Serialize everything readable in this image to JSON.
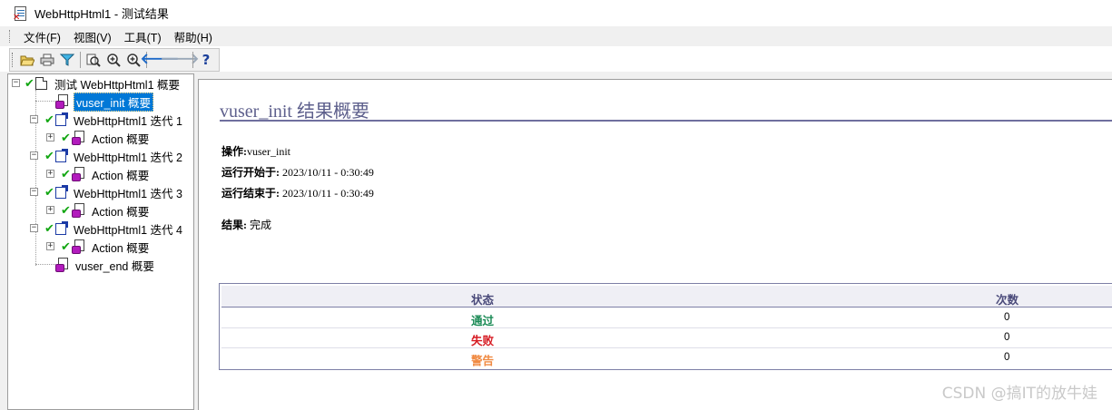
{
  "window": {
    "title": "WebHttpHtml1 - 测试结果"
  },
  "menu": [
    {
      "label": "文件(F)"
    },
    {
      "label": "视图(V)"
    },
    {
      "label": "工具(T)"
    },
    {
      "label": "帮助(H)"
    }
  ],
  "toolbar": {
    "icons": [
      "open-folder-icon",
      "print-icon",
      "filter-icon",
      "find-icon",
      "zoom-in-icon",
      "zoom-out-icon",
      "back-arrow-icon",
      "forward-arrow-icon",
      "help-icon"
    ],
    "help_glyph": "?"
  },
  "tree": {
    "root": "测试 WebHttpHtml1 概要",
    "vuser_init": "vuser_init 概要",
    "iterations": [
      {
        "label": "WebHttpHtml1 迭代 1",
        "action": "Action 概要"
      },
      {
        "label": "WebHttpHtml1 迭代 2",
        "action": "Action 概要"
      },
      {
        "label": "WebHttpHtml1 迭代 3",
        "action": "Action 概要"
      },
      {
        "label": "WebHttpHtml1 迭代 4",
        "action": "Action 概要"
      }
    ],
    "vuser_end": "vuser_end 概要"
  },
  "report": {
    "heading": "vuser_init 结果概要",
    "operation_label": "操作:",
    "operation_value": "vuser_init",
    "start_label": "运行开始于:",
    "start_value": "2023/10/11 - 0:30:49",
    "end_label": "运行结束于:",
    "end_value": "2023/10/11 - 0:30:49",
    "result_label": "结果:",
    "result_value": "完成"
  },
  "stats": {
    "col_status": "状态",
    "col_count": "次数",
    "rows": [
      {
        "label": "通过",
        "count": "0",
        "color": "#1a8a55"
      },
      {
        "label": "失败",
        "count": "0",
        "color": "#d61a22"
      },
      {
        "label": "警告",
        "count": "0",
        "color": "#f08a42"
      }
    ]
  },
  "watermark": "CSDN @搞IT的放牛娃"
}
